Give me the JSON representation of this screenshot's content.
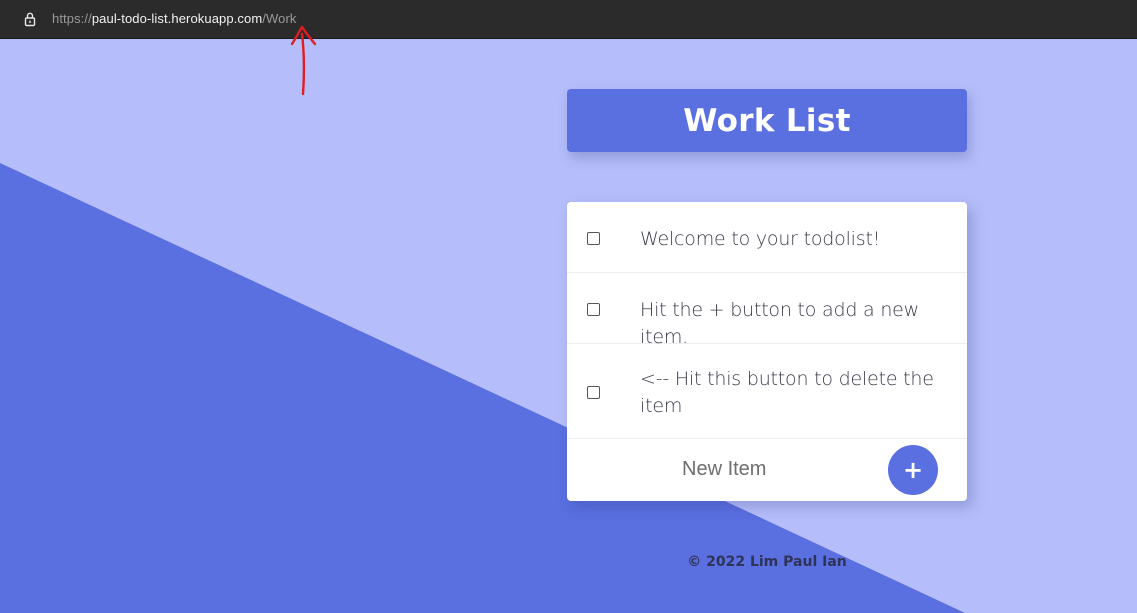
{
  "browser": {
    "url_scheme": "https://",
    "url_host": "paul-todo-list.herokuapp.com",
    "url_path": "/Work",
    "lock_icon": "lock-icon"
  },
  "annotation": {
    "arrow_color": "#e31b23",
    "icon": "hand-drawn-arrow-up-icon"
  },
  "heading": {
    "title": "Work List"
  },
  "todo": {
    "items": [
      {
        "label": "Welcome to your todolist!",
        "checked": false
      },
      {
        "label": "Hit the + button to add a new item.",
        "checked": false
      },
      {
        "label": "<-- Hit this button to delete the item",
        "checked": false
      }
    ],
    "new_item_placeholder": "New Item",
    "add_button_label": "+"
  },
  "footer": {
    "text": "© 2022 Lim Paul Ian"
  },
  "colors": {
    "page_bg_light": "#b5befa",
    "page_bg_dark": "#5a6fe0",
    "accent": "#5a6fe0",
    "card_bg": "#ffffff"
  }
}
